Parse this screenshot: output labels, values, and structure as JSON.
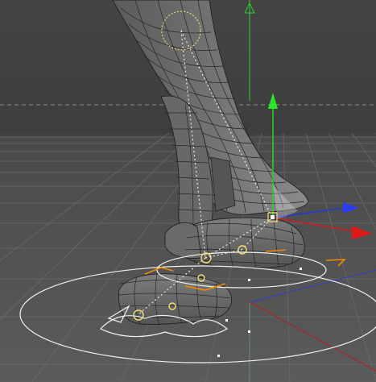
{
  "viewport": {
    "kind": "3d-perspective-viewport",
    "content": "rigged-leg-mesh",
    "colors": {
      "background_top": "#454545",
      "background_bottom": "#5a5a5a",
      "grid": "#6b6b6b",
      "horizon_dash": "#8a8a8a",
      "mesh_fill": "#6f6f6f",
      "mesh_wire": "#202020",
      "control_white": "#f2f2f2",
      "joint_yellow": "#f4e06a",
      "handle_orange": "#f08a00",
      "axis_x": "#d41b1b",
      "axis_y": "#2ad02a",
      "axis_z": "#1d32d6"
    },
    "icons": {
      "move_gizmo": "move-gizmo-icon",
      "pivot_cube": "pivot-cube-icon"
    }
  }
}
